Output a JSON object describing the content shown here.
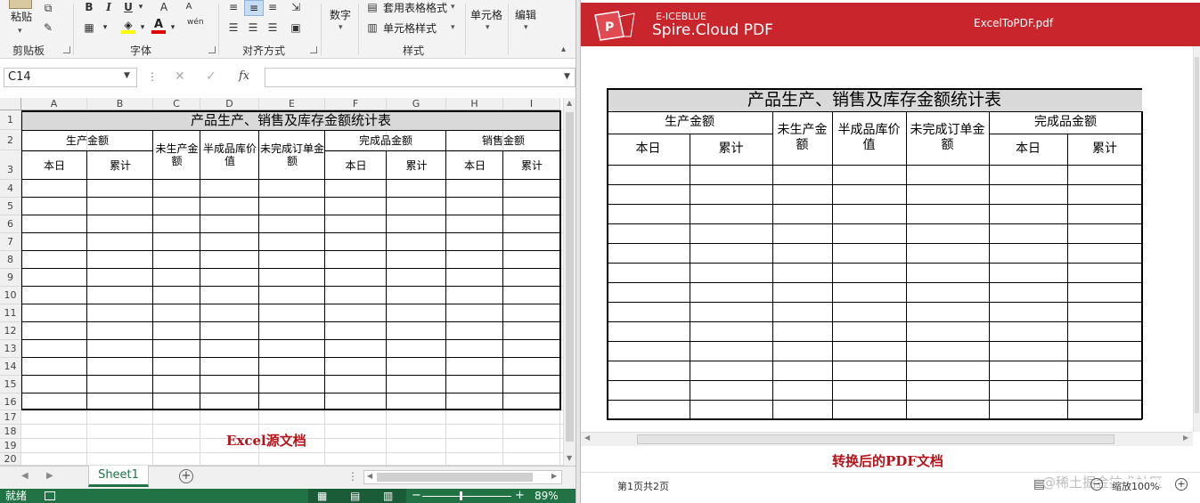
{
  "excel": {
    "ribbon": {
      "paste_label": "粘贴",
      "clipboard_label": "剪贴板",
      "font_label": "字体",
      "align_label": "对齐方式",
      "number_label": "数字",
      "table_style_label": "套用表格格式",
      "cell_style_label": "单元格样式",
      "styles_label": "样式",
      "cells_label": "单元格",
      "edit_label": "编辑",
      "bold": "B",
      "italic": "I",
      "underline": "U",
      "wen": "wén",
      "font_color_a": "A"
    },
    "name_box": "C14",
    "fx": "fx",
    "columns": [
      "A",
      "B",
      "C",
      "D",
      "E",
      "F",
      "G",
      "H",
      "I"
    ],
    "rows": [
      "1",
      "2",
      "3",
      "4",
      "5",
      "6",
      "7",
      "8",
      "9",
      "10",
      "11",
      "12",
      "13",
      "14",
      "15",
      "16",
      "17",
      "18",
      "19",
      "20"
    ],
    "table": {
      "title": "产品生产、销售及库存金额统计表",
      "production_amount": "生产金额",
      "unproduced_amount": "未生产金额",
      "semi_inventory_value": "半成品库价值",
      "unfinished_order_amount": "未完成订单金额",
      "finished_amount": "完成品金额",
      "sales_amount": "销售金额",
      "today": "本日",
      "cumulative": "累计"
    },
    "caption": "Excel源文档",
    "sheet_tab": "Sheet1",
    "status_ready": "就绪",
    "zoom": "89%"
  },
  "pdf": {
    "brand_top": "E-ICEBLUE",
    "brand_name": "Spire.Cloud PDF",
    "filename": "ExcelToPDF.pdf",
    "table": {
      "title": "产品生产、销售及库存金额统计表",
      "production_amount": "生产金额",
      "unproduced_amount": "未生产金额",
      "semi_inventory_value": "半成品库价值",
      "unfinished_order_amount": "未完成订单金额",
      "finished_amount": "完成品金额",
      "today": "本日",
      "cumulative": "累计"
    },
    "caption": "转换后的PDF文档",
    "page_info": "第1页共2页",
    "zoom": "缩放100%",
    "watermark": "@稀土掘金技术社区"
  },
  "colors": {
    "excel_green": "#217346",
    "pdf_red": "#c8252c",
    "caption_red": "#b3141c"
  }
}
